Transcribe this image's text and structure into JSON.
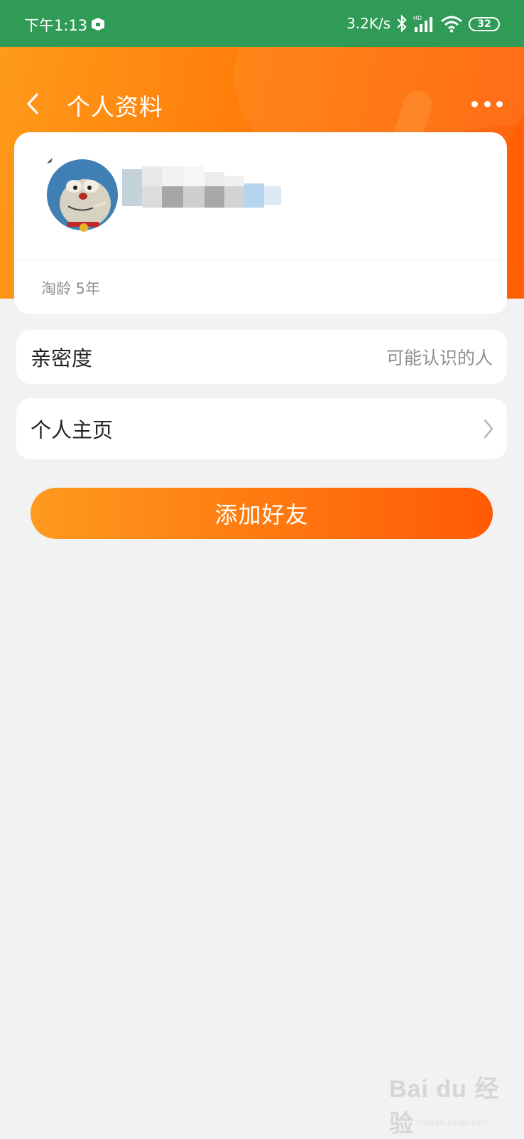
{
  "status_bar": {
    "time": "下午1:13",
    "network_speed": "3.2K/s",
    "battery": "32",
    "icons": [
      "app-notification-icon",
      "bluetooth-icon",
      "hd-signal-icon",
      "wifi-icon",
      "battery-icon"
    ]
  },
  "header": {
    "title": "个人资料",
    "back_icon": "chevron-left-icon",
    "more_icon": "more-dots-icon"
  },
  "profile": {
    "taoling": "淘龄 5年"
  },
  "rows": {
    "intimacy": {
      "label": "亲密度",
      "value": "可能认识的人"
    },
    "homepage": {
      "label": "个人主页"
    }
  },
  "actions": {
    "add_friend": "添加好友"
  },
  "watermark": {
    "text": "Bai du 经验",
    "sub": "jingyan.baidu.com"
  },
  "colors": {
    "status_bar": "#2f9b57",
    "header_start": "#ff9a1a",
    "header_end": "#ff6207",
    "background": "#f2f2f2"
  }
}
